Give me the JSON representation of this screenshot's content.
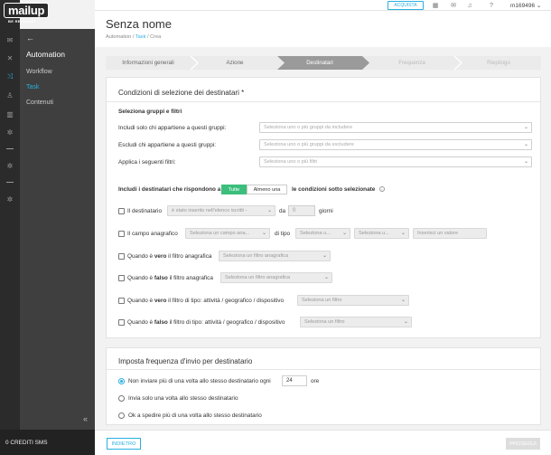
{
  "brand": {
    "name": "mailup",
    "tagline": "BE RELEVANT"
  },
  "topbar": {
    "buy_label": "ACQUISTA",
    "user": "m169496 ⌄"
  },
  "sidebar": {
    "section_title": "Automation",
    "items": [
      {
        "label": "Workflow"
      },
      {
        "label": "Task"
      },
      {
        "label": "Contenuti"
      }
    ],
    "credits": "0 CREDITI SMS"
  },
  "header": {
    "title": "Senza nome",
    "breadcrumb": [
      "Automation",
      "Task",
      "Crea"
    ]
  },
  "steps": [
    {
      "label": "Informazioni generali"
    },
    {
      "label": "Azione"
    },
    {
      "label": "Destinatari"
    },
    {
      "label": "Frequenza"
    },
    {
      "label": "Riepilogo"
    }
  ],
  "conditions": {
    "title": "Condizioni di selezione dei destinatari *",
    "groups_heading": "Seleziona gruppi e filtri",
    "include_label": "Includi solo chi appartiene a questi gruppi:",
    "include_placeholder": "Seleziona uno o più gruppi da includere",
    "exclude_label": "Escludi chi appartiene a questi gruppi:",
    "exclude_placeholder": "Seleziona uno o più gruppi da escludere",
    "filters_label": "Applica i seguenti filtri:",
    "filters_placeholder": "Seleziona uno o più filtri",
    "match_prefix": "Includi i destinatari che rispondono a",
    "match_all": "Tutte",
    "match_any": "Almeno una",
    "match_suffix": "le condizioni sotto selezionate",
    "rows": {
      "recipient": {
        "label": "Il destinatario",
        "select": "è stato inserito nell'elenco iscritti -",
        "da": "da",
        "value": "0",
        "unit": "giorni"
      },
      "field": {
        "label": "Il campo anagrafico",
        "select": "Seleziona un campo ana...",
        "tipo": "di tipo",
        "select2": "Seleziona u...",
        "select3": "Seleziona u...",
        "input": "Inserisci un valore"
      },
      "true_filter": {
        "pre": "Quando è",
        "kw": "vero",
        "post": "il filtro anagrafica",
        "select": "Seleziona un filtro anagrafica"
      },
      "false_filter": {
        "pre": "Quando è",
        "kw": "falso",
        "post": "il filtro anagrafica",
        "select": "Seleziona un filtro anagrafica"
      },
      "true_type": {
        "pre": "Quando è",
        "kw": "vero",
        "post": "il filtro di tipo: attività / geografico / dispositivo",
        "select": "Seleziona un filtro"
      },
      "false_type": {
        "pre": "Quando è",
        "kw": "falso",
        "post": "il filtro di tipo: attività / geografico / dispositivo",
        "select": "Seleziona un filtro"
      }
    }
  },
  "frequency": {
    "title": "Imposta frequenza d'invio per destinatario",
    "opt1_pre": "Non inviare più di una volta allo stesso destinatario ogni",
    "opt1_value": "24",
    "opt1_unit": "ore",
    "opt2": "Invia solo una volta allo stesso destinatario",
    "opt3": "Ok a spedire più di una volta allo stesso destinatario"
  },
  "footer": {
    "back_label": "INDIETRO",
    "next_label": "PROSEGUI"
  },
  "colors": {
    "accent": "#2ab0e0",
    "toggle_active": "#3cbf7c",
    "rail": "#2b2b2b",
    "sidebar": "#3f3f3f"
  }
}
